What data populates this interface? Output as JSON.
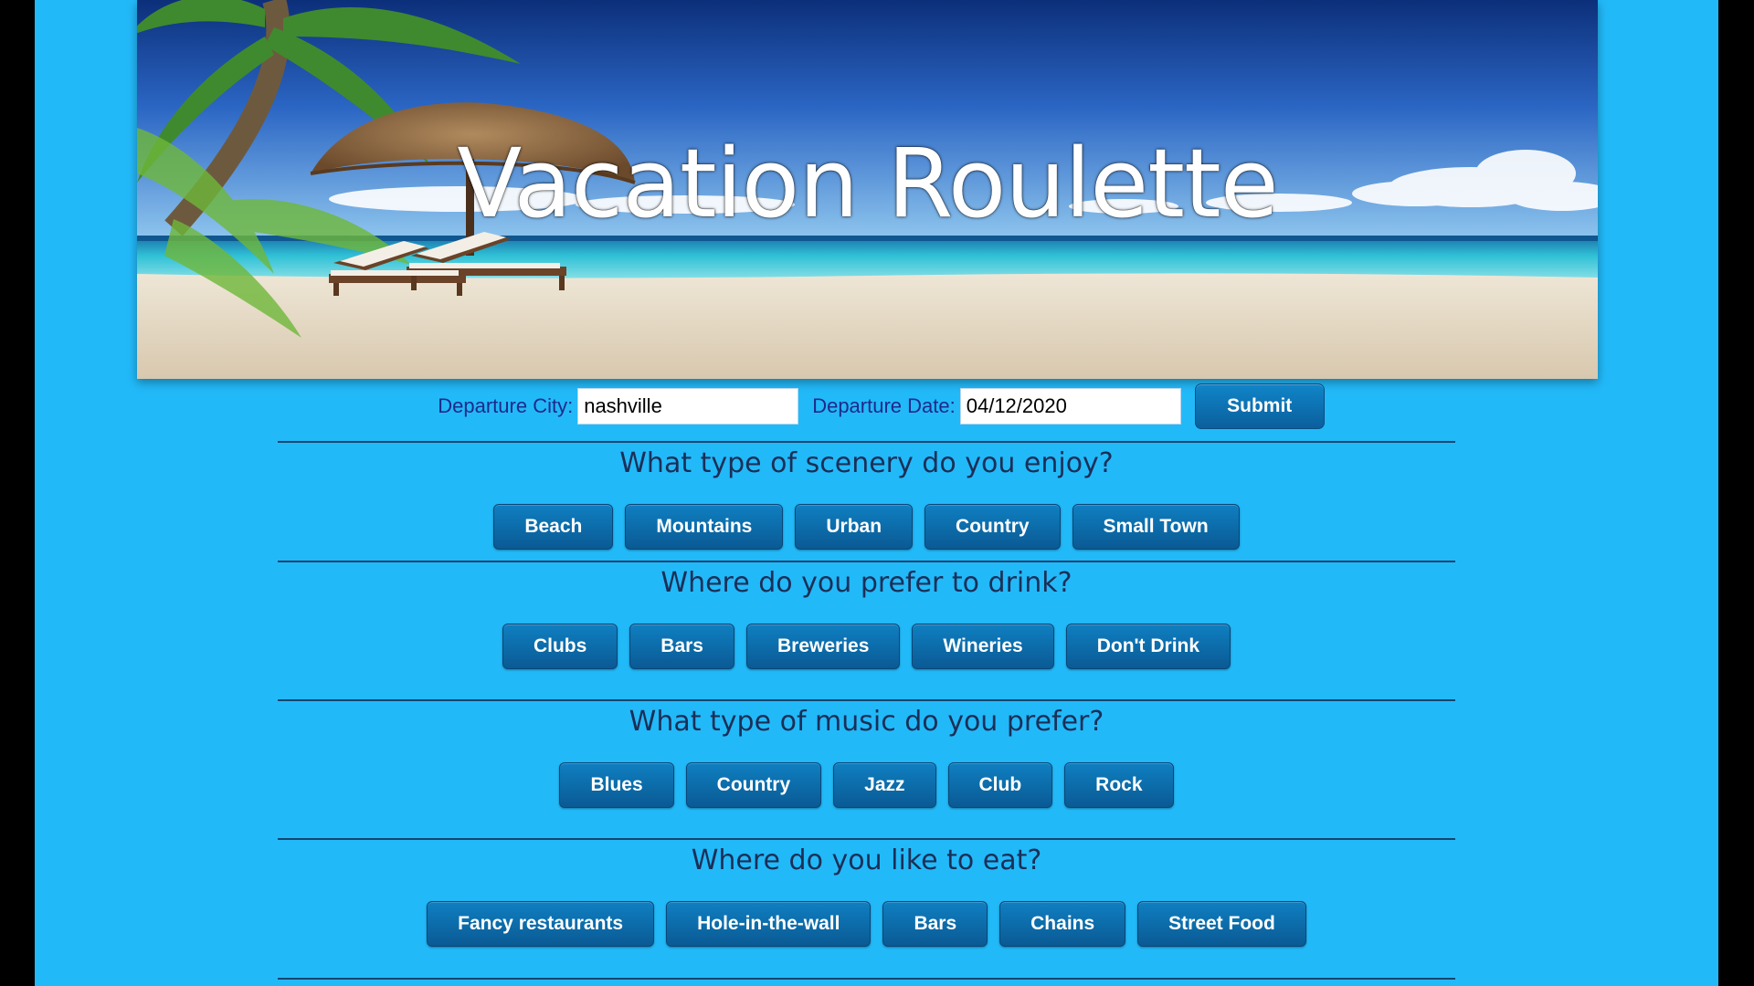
{
  "header": {
    "title": "Vacation Roulette"
  },
  "form": {
    "city_label": "Departure City:",
    "city_value": "nashville",
    "date_label": "Departure Date:",
    "date_value": "04/12/2020",
    "submit_label": "Submit"
  },
  "sections": [
    {
      "question": "What type of scenery do you enjoy?",
      "options": [
        "Beach",
        "Mountains",
        "Urban",
        "Country",
        "Small Town"
      ]
    },
    {
      "question": "Where do you prefer to drink?",
      "options": [
        "Clubs",
        "Bars",
        "Breweries",
        "Wineries",
        "Don't Drink"
      ]
    },
    {
      "question": "What type of music do you prefer?",
      "options": [
        "Blues",
        "Country",
        "Jazz",
        "Club",
        "Rock"
      ]
    },
    {
      "question": "Where do you like to eat?",
      "options": [
        "Fancy restaurants",
        "Hole-in-the-wall",
        "Bars",
        "Chains",
        "Street Food"
      ]
    }
  ],
  "colors": {
    "page_background": "#22b9f9",
    "button": "#0b6aa8",
    "heading_text": "#1b2f57",
    "label_text": "#1e2a8a"
  },
  "icons": {
    "hero_image": "beach-palm-umbrella-loungers"
  }
}
